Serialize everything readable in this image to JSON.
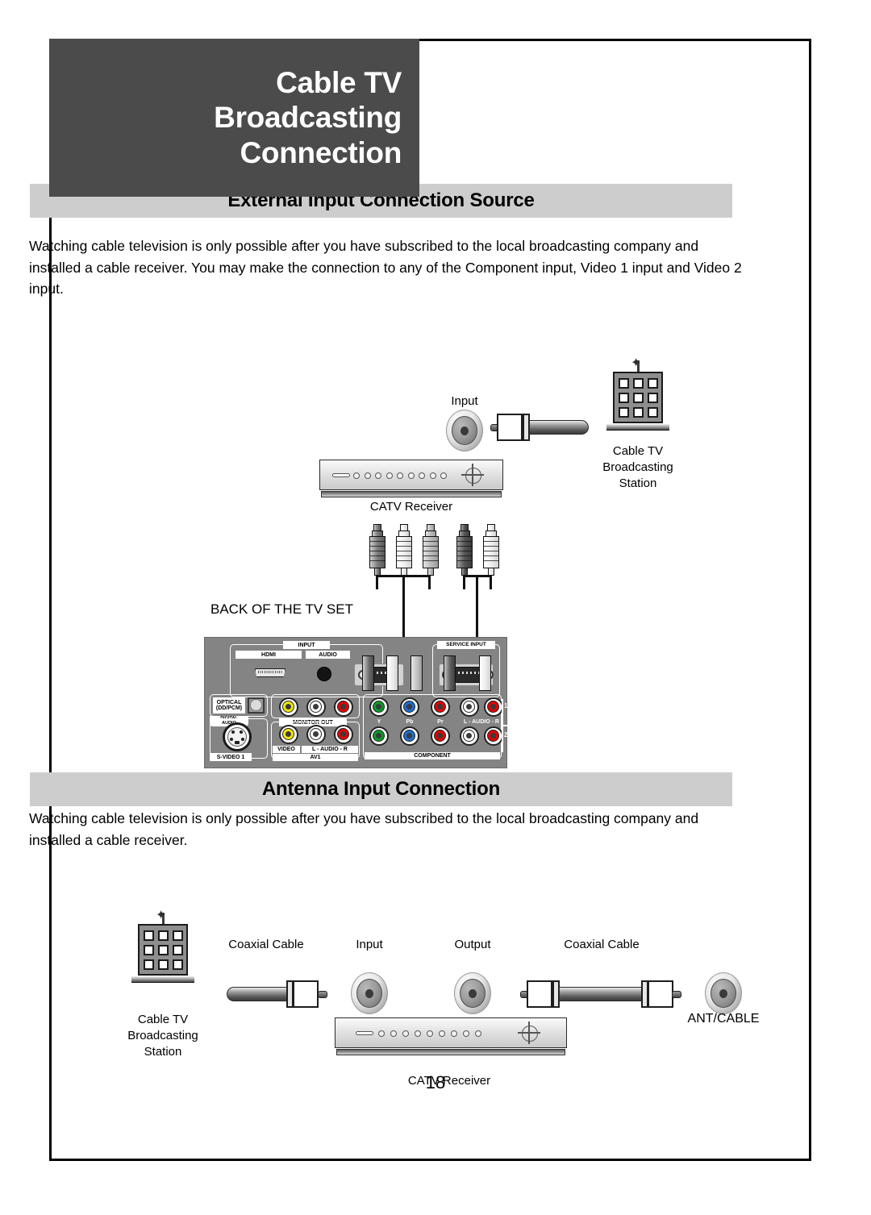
{
  "document": {
    "title_lines": [
      "Cable TV",
      "Broadcasting",
      "Connection"
    ],
    "page_number": "18"
  },
  "sections": [
    {
      "id": "external-input",
      "heading": "External Input Connection Source",
      "body": "Watching cable television is only possible after you have subscribed to the local broadcasting company and installed a cable receiver. You may make the connection to any of the Component input, Video 1 input and Video 2 input."
    },
    {
      "id": "antenna-input",
      "heading": "Antenna Input Connection",
      "body": "Watching cable television is only possible after you have subscribed to the local broadcasting company and installed a cable receiver."
    }
  ],
  "diagram_top": {
    "input_label": "Input",
    "receiver_label": "CATV Receiver",
    "station_label_lines": [
      "Cable TV",
      "Broadcasting",
      "Station"
    ],
    "back_of_tv_label": "BACK OF THE TV SET"
  },
  "tv_panel": {
    "input_group": "INPUT",
    "hdmi": "HDMI",
    "audio": "AUDIO",
    "service_input": "SERVICE INPUT",
    "optical_line1": "OPTICAL",
    "optical_line2": "(DD/PCM)",
    "digital_audio_line1": "DIGITAL",
    "digital_audio_line2": "AUDIO",
    "monitor_out": "MONITOR OUT",
    "s_video": "S-VIDEO 1",
    "video": "VIDEO",
    "l_audio_r_av": "L - AUDIO - R",
    "av1": "AV1",
    "y": "Y",
    "pb": "Pb",
    "pr": "Pr",
    "l_audio_r_comp": "L - AUDIO - R",
    "component": "COMPONENT",
    "row1": "1",
    "row2": "2",
    "colors": {
      "yellow": "#f2e600",
      "white": "#ffffff",
      "red": "#e60000",
      "green": "#0a9c28",
      "blue": "#1c6fd0"
    }
  },
  "diagram_bottom": {
    "station_label_lines": [
      "Cable TV",
      "Broadcasting",
      "Station"
    ],
    "coaxial_cable_left": "Coaxial Cable",
    "input_label": "Input",
    "output_label": "Output",
    "coaxial_cable_right": "Coaxial Cable",
    "ant_cable_label": "ANT/CABLE",
    "receiver_label": "CATV Receiver"
  },
  "theme": {
    "title_block_bg": "#4b4b4b",
    "section_heading_bg": "#cdcdcd",
    "panel_bg": "#848484",
    "text": "#000000"
  }
}
